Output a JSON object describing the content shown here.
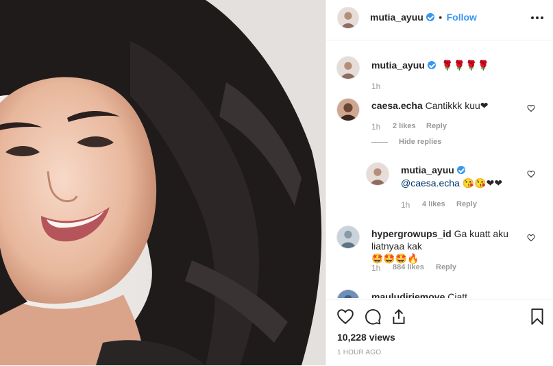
{
  "header": {
    "username": "mutia_ayuu",
    "separator": "•",
    "follow_label": "Follow",
    "more_icon": "more-options-icon"
  },
  "caption": {
    "username": "mutia_ayuu",
    "text": "🌹🌹🌹🌹",
    "time": "1h"
  },
  "comments": [
    {
      "username": "caesa.echa",
      "text": "Cantikkk kuu❤",
      "time": "1h",
      "likes": "2 likes",
      "reply": "Reply",
      "hide_replies": "Hide replies",
      "replies": [
        {
          "username": "mutia_ayuu",
          "mention": "@caesa.echa",
          "emojis": "😘😘❤❤",
          "time": "1h",
          "likes": "4 likes",
          "reply": "Reply"
        }
      ]
    },
    {
      "username": "hypergrowups_id",
      "text_line1": "Ga kuatt aku",
      "text_line2": "liatnyaa kak",
      "emojis": "🤩🤩🤩🔥",
      "time": "1h",
      "likes": "884 likes",
      "reply": "Reply"
    },
    {
      "username": "mauludiriemove",
      "text": "Ciatt"
    }
  ],
  "actions": {
    "like_icon": "heart-outline-icon",
    "comment_icon": "comment-icon",
    "share_icon": "share-icon",
    "save_icon": "bookmark-icon",
    "views": "10,228 views",
    "posted_ago": "1 HOUR AGO"
  },
  "colors": {
    "link_blue": "#3897f0",
    "meta_gray": "#999999",
    "text_dark": "#262626",
    "border": "#efefef"
  }
}
